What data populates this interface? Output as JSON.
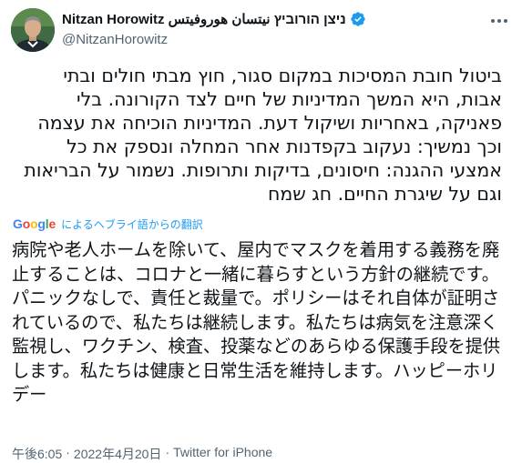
{
  "author": {
    "display_name": "Nitzan Horowitz ניצן הורוביץ نيتسان هوروفيتس",
    "handle": "@NitzanHorowitz",
    "verified": true,
    "verified_icon": "verified-badge-icon",
    "accent_color": "#1d9bf0"
  },
  "tweet": {
    "text": "ביטול חובת המסיכות במקום סגור, חוץ מבתי חולים ובתי אבות, היא המשך המדיניות של חיים לצד הקורונה. בלי פאניקה, באחריות ושיקול דעת. המדיניות הוכיחה את עצמה וכך נמשיך: נעקוב בקפדנות אחר המחלה ונספק את כל אמצעי ההגנה: חיסונים, בדיקות ותרופות. נשמור על הבריאות וגם על שיגרת החיים. חג שמח"
  },
  "translation": {
    "provider": "Google",
    "label": "によるヘブライ語からの翻訳",
    "text": "病院や老人ホームを除いて、屋内でマスクを着用する義務を廃止することは、コロナと一緒に暮らすという方針の継続です。パニックなしで、責任と裁量で。ポリシーはそれ自体が証明されているので、私たちは継続します。私たちは病気を注意深く監視し、ワクチン、検査、投薬などのあらゆる保護手段を提供します。私たちは健康と日常生活を維持します。ハッピーホリデー"
  },
  "meta": {
    "time": "午後6:05",
    "separator": "·",
    "date": "2022年4月20日",
    "source": "Twitter for iPhone"
  },
  "icons": {
    "more": "more-options-icon",
    "avatar": "avatar"
  },
  "colors": {
    "text": "#0f1419",
    "secondary": "#536471",
    "link": "#1d9bf0"
  }
}
